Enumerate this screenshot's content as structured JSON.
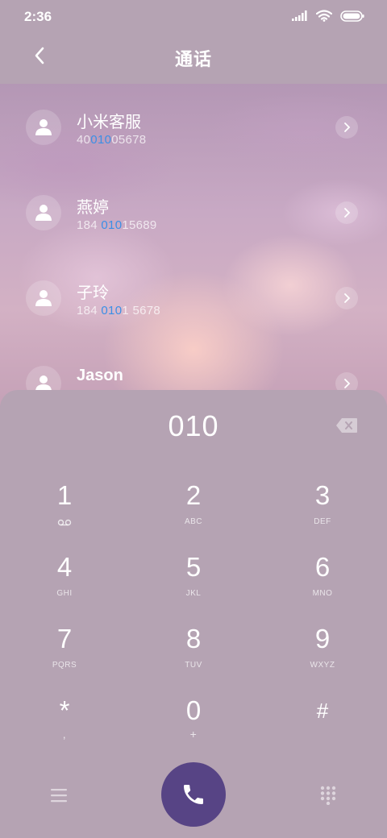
{
  "status_bar": {
    "time": "2:36"
  },
  "header": {
    "title": "通话"
  },
  "contacts": [
    {
      "name": "小米客服",
      "number_pre": "40",
      "number_hl": "010",
      "number_post": "05678"
    },
    {
      "name": "燕婷",
      "number_pre": "184 ",
      "number_hl": "010",
      "number_post": "15689"
    },
    {
      "name": "子玲",
      "number_pre": "184 ",
      "number_hl": "010",
      "number_post": "1 5678"
    },
    {
      "name": "Jason",
      "number_pre": "",
      "number_hl": "",
      "number_post": ""
    }
  ],
  "dialer": {
    "digits": "010",
    "keys": [
      {
        "num": "1",
        "sub": ""
      },
      {
        "num": "2",
        "sub": "ABC"
      },
      {
        "num": "3",
        "sub": "DEF"
      },
      {
        "num": "4",
        "sub": "GHI"
      },
      {
        "num": "5",
        "sub": "JKL"
      },
      {
        "num": "6",
        "sub": "MNO"
      },
      {
        "num": "7",
        "sub": "PQRS"
      },
      {
        "num": "8",
        "sub": "TUV"
      },
      {
        "num": "9",
        "sub": "WXYZ"
      },
      {
        "num": "*",
        "sub": ","
      },
      {
        "num": "0",
        "sub": "+"
      },
      {
        "num": "#",
        "sub": ""
      }
    ]
  },
  "icons": {
    "back": "chevron-left-icon",
    "signal": "signal-icon",
    "wifi": "wifi-icon",
    "battery": "battery-icon",
    "voicemail": "voicemail-icon",
    "backspace": "backspace-icon",
    "menu": "menu-icon",
    "call": "phone-icon",
    "keypad": "keypad-icon"
  },
  "colors": {
    "background": "#b5a3b3",
    "highlight": "#3b8fe6",
    "call_button": "#574485"
  }
}
